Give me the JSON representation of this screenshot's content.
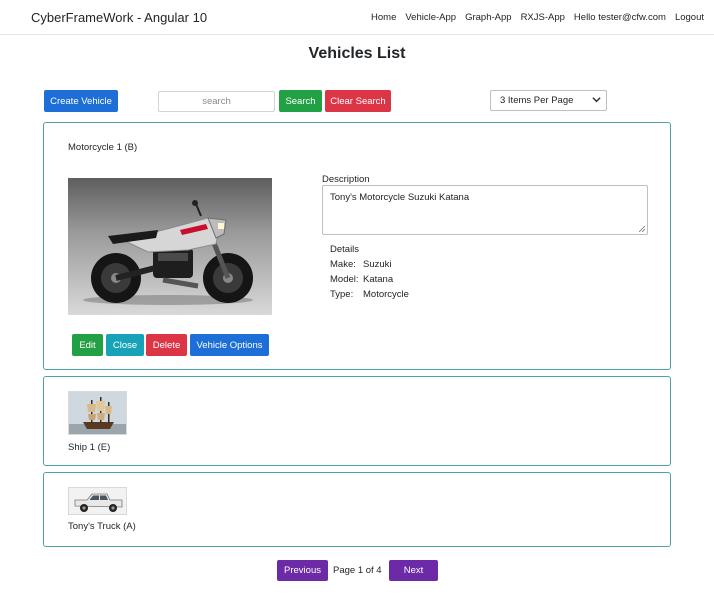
{
  "navbar": {
    "brand": "CyberFrameWork - Angular 10",
    "links": [
      "Home",
      "Vehicle-App",
      "Graph-App",
      "RXJS-App",
      "Hello tester@cfw.com",
      "Logout"
    ]
  },
  "page_title": "Vehicles List",
  "toolbar": {
    "create_label": "Create Vehicle",
    "search_placeholder": "search",
    "search_value": "",
    "search_label": "Search",
    "clear_label": "Clear Search",
    "per_page_selected": "3 Items Per Page"
  },
  "vehicles": [
    {
      "title": "Motorcycle 1 (B)",
      "description_label": "Description",
      "description": "Tony's Motorcycle Suzuki Katana",
      "details_label": "Details",
      "details": [
        {
          "key": "Make:",
          "value": "Suzuki"
        },
        {
          "key": "Model:",
          "value": "Katana"
        },
        {
          "key": "Type:",
          "value": "Motorcycle"
        }
      ],
      "buttons": {
        "edit": "Edit",
        "close": "Close",
        "delete": "Delete",
        "options": "Vehicle Options"
      }
    },
    {
      "title": "Ship 1 (E)"
    },
    {
      "title": "Tony's Truck (A)"
    }
  ],
  "pagination": {
    "previous": "Previous",
    "page_text": "Page 1 of 4",
    "next": "Next"
  },
  "colors": {
    "primary": "#1d6ed6",
    "success": "#22a144",
    "danger": "#dc3545",
    "info": "#17a2b8",
    "purple": "#6c2aa6",
    "card_border": "#4fa3a3"
  }
}
